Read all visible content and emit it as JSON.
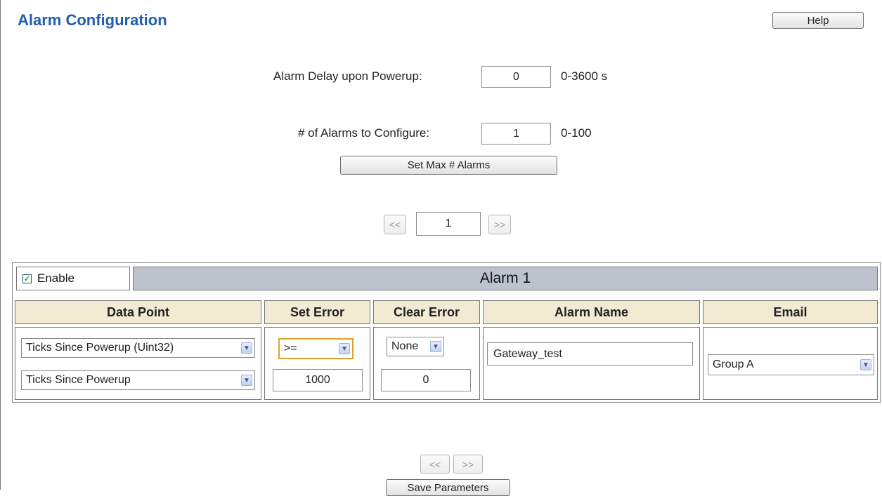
{
  "page_title": "Alarm Configuration",
  "help_button": "Help",
  "alarm_delay": {
    "label": "Alarm Delay upon Powerup:",
    "value": "0",
    "range": "0-3600 s"
  },
  "num_alarms": {
    "label": "# of Alarms to Configure:",
    "value": "1",
    "range": "0-100"
  },
  "set_max_button": "Set Max # Alarms",
  "pager_top": {
    "prev": "<<",
    "page": "1",
    "next": ">>"
  },
  "alarm": {
    "enable_label": "Enable",
    "enabled": true,
    "title": "Alarm 1",
    "columns": [
      "Data Point",
      "Set Error",
      "Clear Error",
      "Alarm Name",
      "Email"
    ],
    "data_point_select": "Ticks Since Powerup (Uint32)",
    "data_point_sub_select": "Ticks Since Powerup",
    "set_error_select": ">=",
    "set_error_value": "1000",
    "clear_error_select": "None",
    "clear_error_value": "0",
    "alarm_name": "Gateway_test",
    "email_select": "Group A"
  },
  "pager_bottom": {
    "prev": "<<",
    "next": ">>"
  },
  "save_button": "Save Parameters",
  "colors": {
    "title": "#1f5fad",
    "header_bg": "#bdc3cc",
    "col_header_bg": "#f2ead2",
    "focus_border": "#e0a030"
  }
}
